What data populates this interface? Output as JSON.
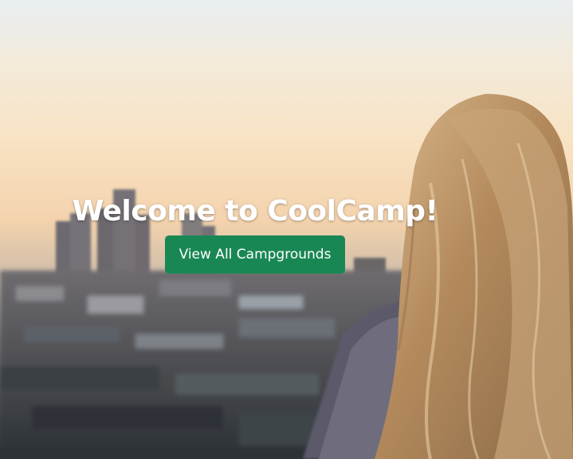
{
  "hero": {
    "title": "Welcome to CoolCamp!",
    "button_label": "View All Campgrounds",
    "button_color": "#198754"
  },
  "background": {
    "subject": "person-with-long-hair-overlooking-city-skyline-at-sunset"
  }
}
